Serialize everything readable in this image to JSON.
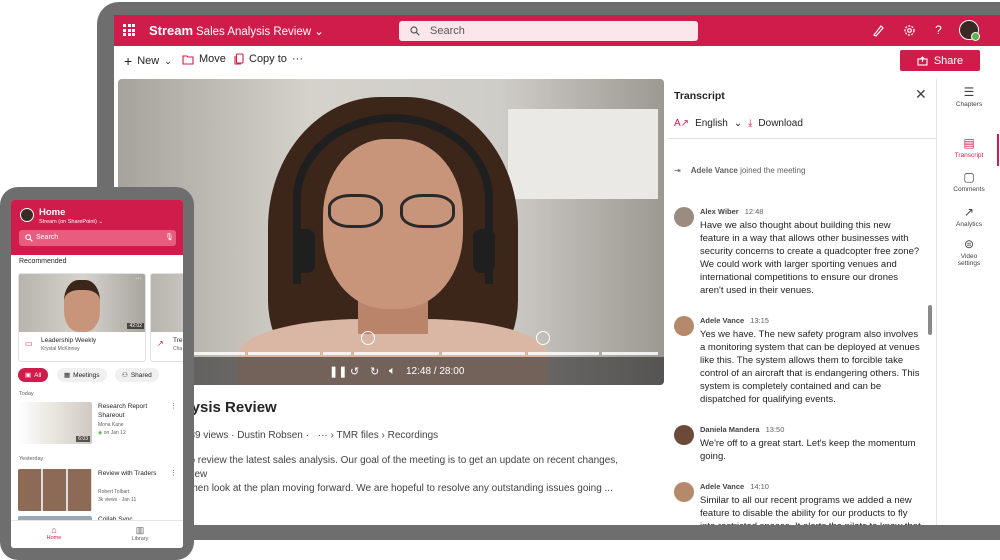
{
  "app": {
    "name": "Stream",
    "breadcrumb": "Sales Analysis Review",
    "search_placeholder": "Search"
  },
  "commands": {
    "new": "New",
    "move": "Move",
    "copy_to": "Copy to",
    "more": "···",
    "share": "Share"
  },
  "video": {
    "time": "12:48 / 28:00",
    "progress_fraction": 0.46,
    "title_visible": "nalysis Review",
    "meta": {
      "views": "10,589 views",
      "author": "Dustin Robsen",
      "more": "···",
      "folder": "TMR files",
      "subfolder": "Recordings"
    },
    "description_line1": "me to review the latest sales analysis. Our goal of the meeting is to get an update on recent changes, any new",
    "description_line2": "and then look at the plan moving forward. We are hopeful to resolve any outstanding issues going ..."
  },
  "transcript": {
    "heading": "Transcript",
    "language": "English",
    "download": "Download",
    "system_event": {
      "name": "Adele Vance",
      "text": "joined the meeting"
    },
    "entries": [
      {
        "name": "Alex Wiber",
        "time": "12:48",
        "text": "Have we also thought about building this new feature in a way that allows other businesses with security concerns to create a quadcopter free zone? We could work with larger sporting venues and international competitions to ensure our drones aren't used in their venues."
      },
      {
        "name": "Adele Vance",
        "time": "13:15",
        "text": "Yes we have. The new safety program also involves a monitoring system that can be deployed at venues like this. The system allows them to forcible take control of an aircraft that is endangering others. This system is completely contained and can be dispatched for qualifying events."
      },
      {
        "name": "Daniela Mandera",
        "time": "13:50",
        "text": "We're off to a great start. Let's keep the momentum going."
      },
      {
        "name": "Adele Vance",
        "time": "14:10",
        "text": "Similar to all our recent programs we added a new feature to disable the ability for our products to fly into restricted spaces. It alerts the pilots to know that they are flying in an unsafe area."
      }
    ]
  },
  "rail": {
    "chapters": "Chapters",
    "transcript": "Transcript",
    "comments": "Comments",
    "analytics": "Analytics",
    "video_settings": "Video settings"
  },
  "phone": {
    "title": "Home",
    "subtitle": "Stream (on SharePoint)",
    "search_placeholder": "Search",
    "recommended": "Recommended",
    "card1": {
      "title": "Leadership Weekly",
      "author": "Krystal McKinney",
      "duration": "42:02"
    },
    "card2": {
      "title": "Tre",
      "author": "Cha"
    },
    "chips": [
      "All",
      "Meetings",
      "Shared"
    ],
    "today": "Today",
    "item1": {
      "title": "Research Report Shareout",
      "author": "Mona Kane",
      "meta": "on Jan 12",
      "duration": "6:03"
    },
    "yesterday": "Yesterday",
    "item2": {
      "title": "Review with Traders",
      "author": "Robert Tolbart",
      "meta": "3k views · Jan 11"
    },
    "item3_title": "Collab Sync",
    "nav_home": "Home",
    "nav_library": "Library"
  },
  "colors": {
    "brand": "#d01c4b"
  }
}
